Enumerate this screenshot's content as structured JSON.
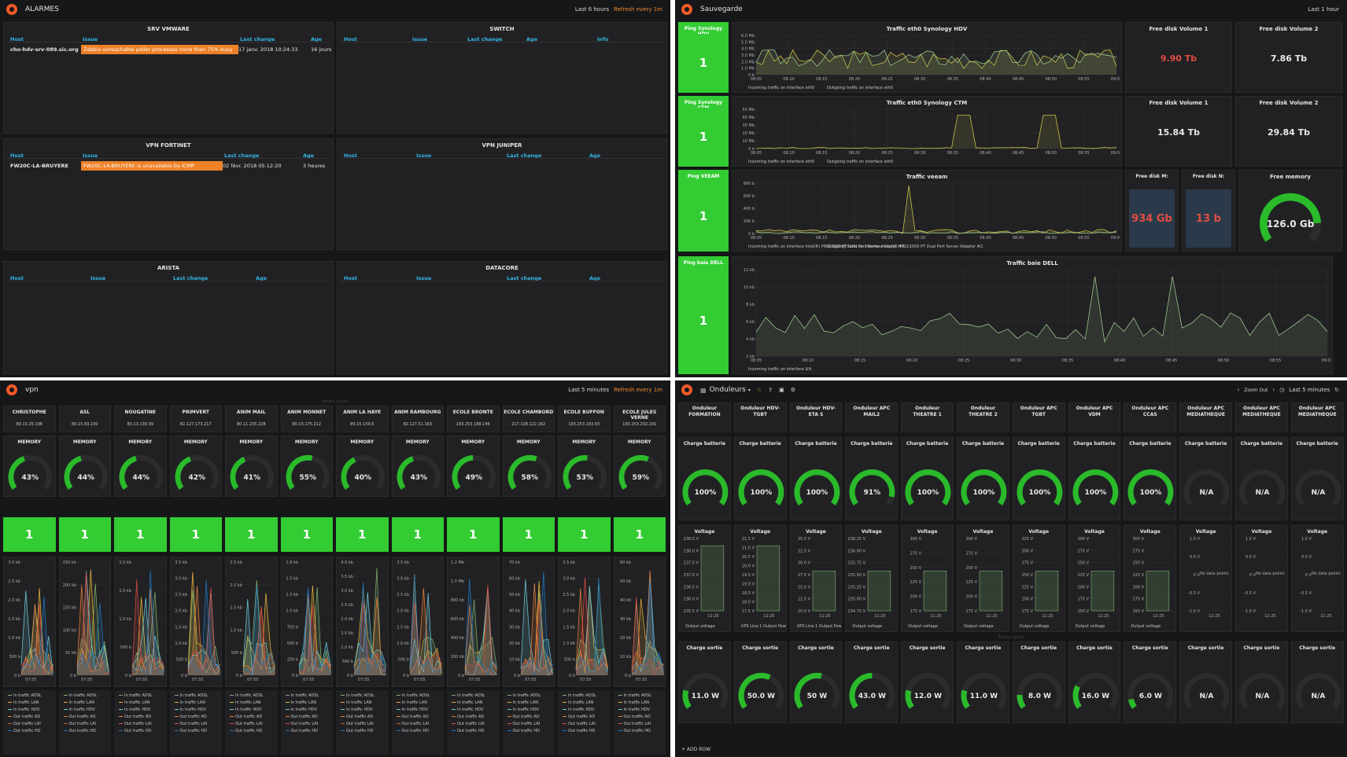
{
  "alarmes": {
    "title": "ALARMES",
    "range": "Last 6 hours",
    "refresh": "Refresh every 1m",
    "panels": [
      {
        "title": "SRV VMWARE",
        "headers": [
          "Host",
          "Issue",
          "Last change",
          "Age"
        ],
        "rows": [
          {
            "host": "cho-hdv-srv-089.sic.org",
            "issue": "Zabbix unreachable poller processes more than 75% busy",
            "change": "17 janv. 2018 10:24:33",
            "age": "16 jours"
          }
        ]
      },
      {
        "title": "SWITCH",
        "headers": [
          "Host",
          "Issue",
          "Last change",
          "Age",
          "Info"
        ],
        "rows": []
      },
      {
        "title": "VPN FORTINET",
        "headers": [
          "Host",
          "Issue",
          "Last change",
          "Age"
        ],
        "rows": [
          {
            "host": "FW20C-LA-BRUYERE",
            "issue": "FW20C-LA-BRUYERE is unavailable by ICMP",
            "change": "02 févr. 2018 05:12:20",
            "age": "3 heures"
          }
        ]
      },
      {
        "title": "VPN JUNIPER",
        "headers": [
          "Host",
          "Issue",
          "Last change",
          "Age"
        ],
        "rows": []
      },
      {
        "title": "ARISTA",
        "headers": [
          "Host",
          "Issue",
          "Last change",
          "Age"
        ],
        "rows": []
      },
      {
        "title": "DATACORE",
        "headers": [
          "Host",
          "Issue",
          "Last change",
          "Age"
        ],
        "rows": []
      }
    ]
  },
  "sauvegarde": {
    "title": "Sauvegarde",
    "range": "Last 1 hour",
    "pings": [
      {
        "title": "Ping Synology HDV",
        "value": "1"
      },
      {
        "title": "Ping Synology CTM",
        "value": "1"
      },
      {
        "title": "Ping VEEAM",
        "value": "1"
      },
      {
        "title": "Ping baie DELL",
        "value": "1"
      }
    ],
    "graphs": [
      {
        "title": "Traffic eth0 Synology HDV",
        "yticks": [
          "6.0 Mb",
          "5.0 Mb",
          "4.0 Mb",
          "3.0 Mb",
          "2.0 Mb",
          "1.0 Mb",
          "0 b"
        ],
        "legend": [
          "Incoming traffic on interface eth0",
          "Outgoing traffic on interface eth0"
        ]
      },
      {
        "title": "Traffic eth0 Synology CTM",
        "yticks": [
          "50 Mb",
          "40 Mb",
          "30 Mb",
          "20 Mb",
          "10 Mb",
          "0 b"
        ],
        "legend": [
          "Incoming traffic on interface eth0",
          "Outgoing traffic on interface eth0"
        ]
      },
      {
        "title": "Traffic veeam",
        "yticks": [
          "800 b",
          "600 b",
          "400 b",
          "200 b",
          "0 b"
        ],
        "legend": [
          "Incoming traffic on interface Intel(R) PRO/1000 PT Dual Port Server Adapter #2.",
          "Outgoing traffic on interface Intel(R) PRO/1000 PT Dual Port Server Adapter #2."
        ]
      },
      {
        "title": "Traffic baie DELL",
        "yticks": [
          "12 kb",
          "10 kb",
          "8 kb",
          "6 kb",
          "4 kb",
          "2 kb"
        ],
        "legend": [
          "Incoming traffic on interface &lt;"
        ]
      }
    ],
    "xticks": [
      "08:05",
      "08:10",
      "08:15",
      "08:20",
      "08:25",
      "08:30",
      "08:35",
      "08:40",
      "08:45",
      "08:50",
      "08:55",
      "09:00"
    ],
    "stats": [
      {
        "title": "Free disk Volume 1",
        "value": "9.90 Tb",
        "color": "#e24d42"
      },
      {
        "title": "Free disk Volume 2",
        "value": "7.86 Tb",
        "color": "#e8e8e8"
      },
      {
        "title": "Free disk Volume 1",
        "value": "15.84 Tb",
        "color": "#e8e8e8"
      },
      {
        "title": "Free disk Volume 2",
        "value": "29.84 Tb",
        "color": "#e8e8e8"
      },
      {
        "title": "Free disk M:",
        "value": "934 Gb",
        "color": "#e24d42"
      },
      {
        "title": "Free disk N:",
        "value": "13 b",
        "color": "#e24d42"
      }
    ],
    "memory": {
      "title": "Free memory",
      "value": "126.0 Gb",
      "fraction": 0.85
    }
  },
  "vpn": {
    "title": "vpn",
    "range": "Last 5 minutes",
    "refresh": "Refresh every 1m",
    "empty": "Empty Space",
    "memory_label": "MEMORY",
    "time": "07:55",
    "legend": [
      "In traffic ADSL",
      "In traffic LAN",
      "In traffic HDV",
      "Out traffic AD",
      "Out traffic LAI",
      "Out traffic HD"
    ],
    "sites": [
      {
        "name": "CHRISTOPHE",
        "ip": "80.13.25.198",
        "mem": 43,
        "ping": "1",
        "yticks": [
          "3.0 kb",
          "2.5 kb",
          "2.0 kb",
          "1.5 kb",
          "1.0 kb",
          "500 b",
          "0 b"
        ]
      },
      {
        "name": "ASL",
        "ip": "80.15.83.100",
        "mem": 44,
        "ping": "1",
        "yticks": [
          "250 kb",
          "200 kb",
          "150 kb",
          "100 kb",
          "50 kb",
          "0 b"
        ]
      },
      {
        "name": "NOUGATINE",
        "ip": "80.13.139.39",
        "mem": 44,
        "ping": "1",
        "yticks": [
          "2.0 kb",
          "1.5 kb",
          "1.0 kb",
          "500 b",
          "0 b"
        ]
      },
      {
        "name": "PRIMVERT",
        "ip": "82.127.173.217",
        "mem": 42,
        "ping": "1",
        "yticks": [
          "3.5 kb",
          "3.0 kb",
          "2.5 kb",
          "2.0 kb",
          "1.5 kb",
          "1.0 kb",
          "500 b",
          "0 b"
        ]
      },
      {
        "name": "ANIM MAIL",
        "ip": "80.11.235.228",
        "mem": 41,
        "ping": "1",
        "yticks": [
          "2.5 kb",
          "2.0 kb",
          "1.5 kb",
          "1.0 kb",
          "500 b",
          "0 b"
        ]
      },
      {
        "name": "ANIM MONNET",
        "ip": "80.13.175.212",
        "mem": 55,
        "ping": "1",
        "yticks": [
          "1.8 kb",
          "1.5 kb",
          "1.3 kb",
          "1.0 kb",
          "750 b",
          "500 b",
          "250 b",
          "0 b"
        ]
      },
      {
        "name": "ANIM LA HAYE",
        "ip": "80.15.159.6",
        "mem": 40,
        "ping": "1",
        "yticks": [
          "4.0 kb",
          "3.5 kb",
          "3.0 kb",
          "2.5 kb",
          "2.0 kb",
          "1.5 kb",
          "1.0 kb",
          "500 b",
          "0 b"
        ]
      },
      {
        "name": "ANIM RAMBOURG",
        "ip": "82.127.51.163",
        "mem": 43,
        "ping": "1",
        "yticks": [
          "3.5 kb",
          "3.0 kb",
          "2.5 kb",
          "2.0 kb",
          "1.5 kb",
          "1.0 kb",
          "500 b",
          "0 b"
        ]
      },
      {
        "name": "ECOLE BRONTE",
        "ip": "193.253.188.146",
        "mem": 49,
        "ping": "1",
        "yticks": [
          "1.2 Mb",
          "1.0 Mb",
          "800 kb",
          "600 kb",
          "400 kb",
          "200 kb",
          "0 b"
        ]
      },
      {
        "name": "ECOLE CHAMBORD",
        "ip": "217.128.122.162",
        "mem": 58,
        "ping": "1",
        "yticks": [
          "70 kb",
          "60 kb",
          "50 kb",
          "40 kb",
          "30 kb",
          "20 kb",
          "10 kb",
          "0 b"
        ]
      },
      {
        "name": "ECOLE BUFFON",
        "ip": "193.253.193.93",
        "mem": 53,
        "ping": "1",
        "yticks": [
          "3.5 kb",
          "3.0 kb",
          "2.5 kb",
          "2.0 kb",
          "1.5 kb",
          "1.0 kb",
          "500 b",
          "0 b"
        ]
      },
      {
        "name": "ECOLE JULES VERNE",
        "ip": "193.253.202.191",
        "mem": 59,
        "ping": "1",
        "yticks": [
          "60 kb",
          "50 kb",
          "40 kb",
          "30 kb",
          "20 kb",
          "10 kb",
          "0 b"
        ]
      }
    ]
  },
  "onduleurs": {
    "title": "Onduleurs",
    "zoom": "Zoom Out",
    "range": "Last 5 minutes",
    "empty": "Empty Space",
    "add_row": "ADD ROW",
    "charge_label": "Charge batterie",
    "voltage_label": "Voltage",
    "out_label": "Charge sortie",
    "time": "11:25",
    "nodata": "No data points",
    "units": [
      {
        "name": "Onduleur FORMATION",
        "charge": "100%",
        "cf": 1.0,
        "vticks": [
          "238.5 V",
          "238.0 V",
          "237.5 V",
          "237.0 V",
          "236.5 V",
          "236.0 V",
          "235.5 V"
        ],
        "vlegend": "Output voltage",
        "out": "11.0 W",
        "of": 0.2
      },
      {
        "name": "Onduleur HDV-TGBT",
        "charge": "100%",
        "cf": 1.0,
        "vticks": [
          "21.5 V",
          "21.0 V",
          "20.5 V",
          "20.0 V",
          "19.5 V",
          "19.0 V",
          "18.5 V",
          "18.0 V",
          "17.5 V"
        ],
        "vlegend": "UPS Line 1 Output Pow",
        "out": "50.0 W",
        "of": 0.6
      },
      {
        "name": "Onduleur HDV-ETA S",
        "charge": "100%",
        "cf": 1.0,
        "vticks": [
          "35.0 V",
          "32.5 V",
          "30.0 V",
          "27.5 V",
          "25.0 V",
          "22.5 V",
          "20.0 V"
        ],
        "vlegend": "UPS Line 1 Output Pow",
        "out": "50 W",
        "of": 0.55
      },
      {
        "name": "Onduleur APC MAIL2",
        "charge": "91%",
        "cf": 0.91,
        "vticks": [
          "238.25 V",
          "236.00 V",
          "235.75 V",
          "235.50 V",
          "235.25 V",
          "235.00 V",
          "234.75 V"
        ],
        "vlegend": "Output voltage",
        "out": "43.0 W",
        "of": 0.5
      },
      {
        "name": "Onduleur THEATRE 1",
        "charge": "100%",
        "cf": 1.0,
        "vticks": [
          "300 V",
          "275 V",
          "250 V",
          "225 V",
          "200 V",
          "175 V"
        ],
        "vlegend": "Output voltage",
        "out": "12.0 W",
        "of": 0.2
      },
      {
        "name": "Onduleur THEATRE 2",
        "charge": "100%",
        "cf": 1.0,
        "vticks": [
          "300 V",
          "275 V",
          "250 V",
          "225 V",
          "200 V",
          "175 V"
        ],
        "vlegend": "Output voltage",
        "out": "11.0 W",
        "of": 0.2
      },
      {
        "name": "Onduleur APC TGBT",
        "charge": "100%",
        "cf": 1.0,
        "vticks": [
          "325 V",
          "300 V",
          "275 V",
          "250 V",
          "225 V",
          "200 V",
          "175 V"
        ],
        "vlegend": "Output voltage",
        "out": "8.0 W",
        "of": 0.15
      },
      {
        "name": "Onduleur APC VDM",
        "charge": "100%",
        "cf": 1.0,
        "vticks": [
          "300 V",
          "275 V",
          "250 V",
          "225 V",
          "200 V",
          "175 V",
          "150 V"
        ],
        "vlegend": "Output voltage",
        "out": "16.0 W",
        "of": 0.25
      },
      {
        "name": "Onduleur APC CCAS",
        "charge": "100%",
        "cf": 1.0,
        "vticks": [
          "300 V",
          "275 V",
          "250 V",
          "225 V",
          "200 V",
          "175 V",
          "150 V"
        ],
        "vlegend": "Output voltage",
        "out": "6.0 W",
        "of": 0.1
      },
      {
        "name": "Onduleur APC MEDIATHEQUE",
        "charge": "N/A",
        "cf": 0,
        "vticks": [
          "1.0 V",
          "0.5 V",
          "0 V",
          "-0.5 V",
          "-1.0 V"
        ],
        "vlegend": "",
        "out": "N/A",
        "of": 0
      },
      {
        "name": "Onduleur APC MEDIATHEQUE",
        "charge": "N/A",
        "cf": 0,
        "vticks": [
          "1.0 V",
          "0.5 V",
          "0 V",
          "-0.5 V",
          "-1.0 V"
        ],
        "vlegend": "",
        "out": "N/A",
        "of": 0
      },
      {
        "name": "Onduleur APC MEDIATHEQUE",
        "charge": "N/A",
        "cf": 0,
        "vticks": [
          "1.0 V",
          "0.5 V",
          "0 V",
          "-0.5 V",
          "-1.0 V"
        ],
        "vlegend": "",
        "out": "N/A",
        "of": 0
      }
    ]
  }
}
